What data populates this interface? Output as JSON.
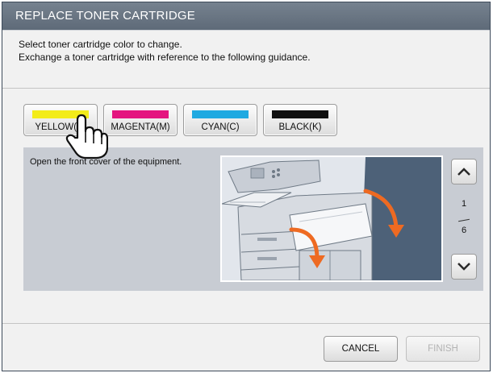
{
  "window": {
    "title": "REPLACE TONER CARTRIDGE"
  },
  "instructions": {
    "line1": "Select toner cartridge color to change.",
    "line2": "Exchange a toner cartridge with reference to the following guidance."
  },
  "colors": [
    {
      "label": "YELLOW(Y)",
      "swatch": "#f3ec1a"
    },
    {
      "label": "MAGENTA(M)",
      "swatch": "#e4157f"
    },
    {
      "label": "CYAN(C)",
      "swatch": "#1fa9e1"
    },
    {
      "label": "BLACK(K)",
      "swatch": "#111111"
    }
  ],
  "guide": {
    "text": "Open the front cover of the equipment.",
    "page_current": "1",
    "page_total": "6"
  },
  "actions": {
    "cancel": "CANCEL",
    "finish": "FINISH"
  },
  "theme": {
    "arrow_color": "#ee6a22",
    "dark_panel": "#4d6178"
  }
}
